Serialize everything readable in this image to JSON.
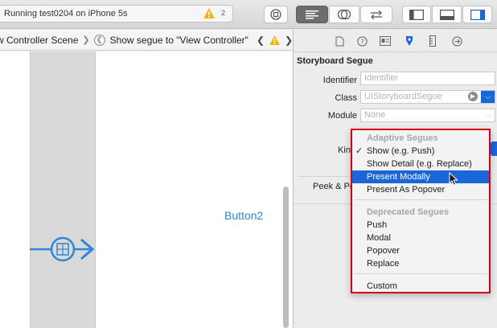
{
  "toolbar": {
    "activity_text": "Running test0204 on iPhone 5s",
    "warning_count": "2"
  },
  "jumpbar": {
    "scene": "w Controller Scene",
    "segue": "Show segue to \"View Controller\""
  },
  "canvas": {
    "button_label": "Button2"
  },
  "inspector": {
    "section_title": "Storyboard Segue",
    "identifier_label": "Identifier",
    "identifier_placeholder": "Identifier",
    "class_label": "Class",
    "class_value": "UIStoryboardSegue",
    "module_label": "Module",
    "module_value": "None",
    "kind_label": "Kin",
    "peek_label": "Peek & Po"
  },
  "menu": {
    "adaptive_header": "Adaptive Segues",
    "items_adaptive": [
      "Show (e.g. Push)",
      "Show Detail (e.g. Replace)",
      "Present Modally",
      "Present As Popover"
    ],
    "deprecated_header": "Deprecated Segues",
    "items_deprecated": [
      "Push",
      "Modal",
      "Popover",
      "Replace"
    ],
    "custom": "Custom",
    "checked_item": "Show (e.g. Push)",
    "highlighted_item": "Present Modally"
  },
  "colors": {
    "accent": "#1a66d8",
    "highlight_border": "#d0021b",
    "link": "#2f86d6"
  }
}
